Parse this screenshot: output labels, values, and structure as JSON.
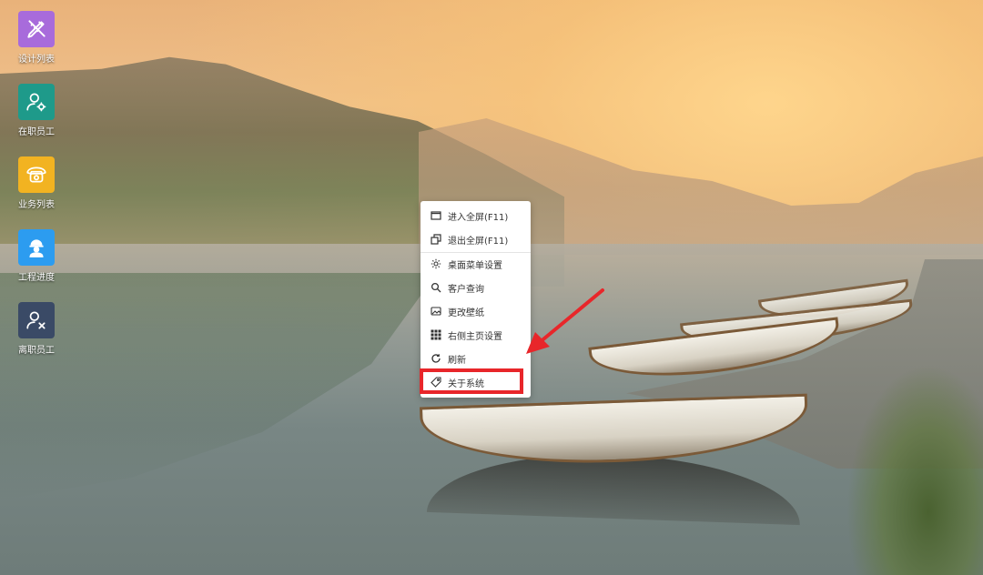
{
  "desktop_icons": [
    {
      "label": "设计列表",
      "icon": "pencil-ruler-icon",
      "color": "#a86bdb"
    },
    {
      "label": "在职员工",
      "icon": "user-gear-icon",
      "color": "#1e9a8a"
    },
    {
      "label": "业务列表",
      "icon": "telephone-icon",
      "color": "#f2b321"
    },
    {
      "label": "工程进度",
      "icon": "worker-icon",
      "color": "#2c9cf0"
    },
    {
      "label": "离职员工",
      "icon": "user-remove-icon",
      "color": "#3a4a66"
    }
  ],
  "context_menu": {
    "items": [
      {
        "label": "进入全屏(F11)",
        "icon": "window-maximize-icon"
      },
      {
        "label": "退出全屏(F11)",
        "icon": "window-restore-icon"
      },
      {
        "label": "桌面菜单设置",
        "icon": "gear-icon"
      },
      {
        "label": "客户查询",
        "icon": "search-icon"
      },
      {
        "label": "更改壁纸",
        "icon": "image-icon"
      },
      {
        "label": "右侧主页设置",
        "icon": "grid-icon"
      },
      {
        "label": "刷新",
        "icon": "refresh-icon"
      },
      {
        "label": "关于系统",
        "icon": "tag-icon"
      }
    ]
  },
  "annotation_color": "#e8262a"
}
